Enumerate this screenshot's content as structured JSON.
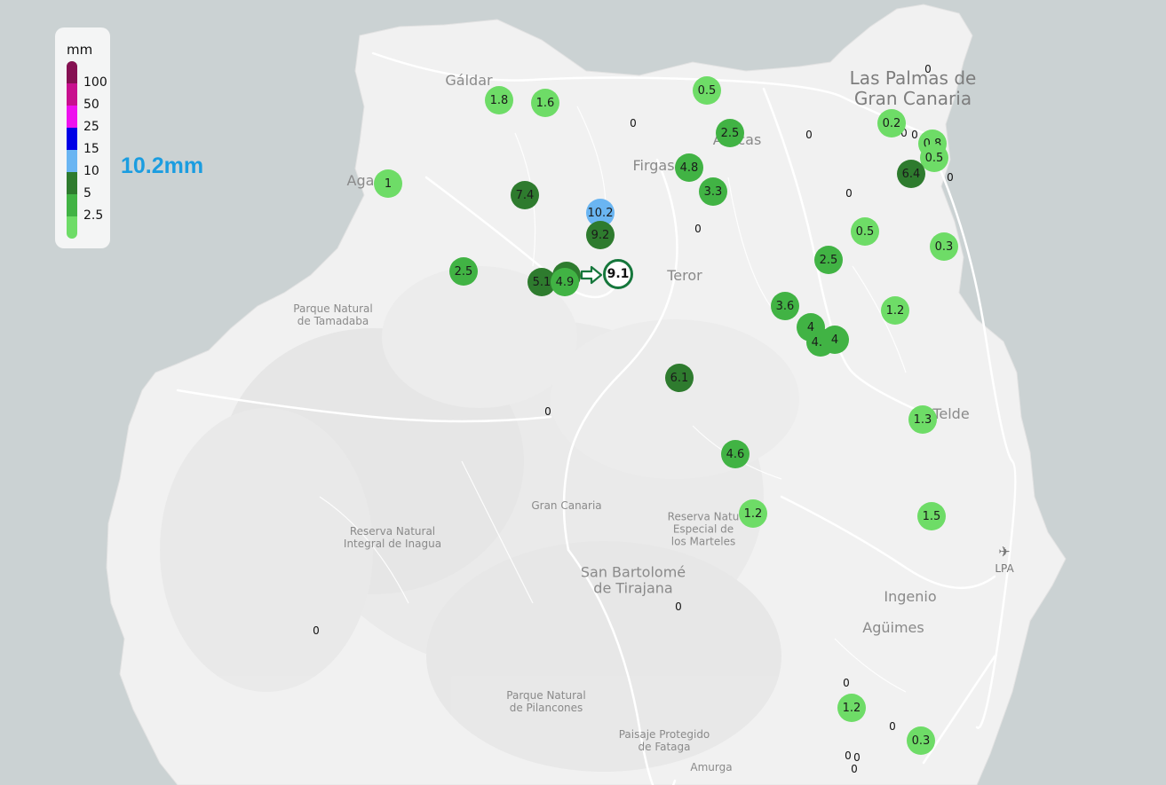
{
  "colors": {
    "sea": "#cbd2d3",
    "land": "#f1f1f1",
    "selected_ring": "#16773c",
    "max_value_text": "#1b9de0"
  },
  "legend": {
    "unit": "mm",
    "ticks": [
      "100",
      "50",
      "25",
      "15",
      "10",
      "5",
      "2.5"
    ],
    "color_scale": [
      {
        "from": 0,
        "to": 2.5,
        "color": "#6edc67"
      },
      {
        "from": 2.5,
        "to": 5,
        "color": "#41b344"
      },
      {
        "from": 5,
        "to": 10,
        "color": "#2e7b2e"
      },
      {
        "from": 10,
        "to": 15,
        "color": "#6ab5f2"
      },
      {
        "from": 15,
        "to": 25,
        "color": "#0000e6"
      },
      {
        "from": 25,
        "to": 50,
        "color": "#ee11ee"
      },
      {
        "from": 50,
        "to": 100,
        "color": "#c8108e"
      },
      {
        "from": 100,
        "to": 1000,
        "color": "#851052"
      }
    ]
  },
  "max_value": "10.2mm",
  "places": {
    "las_palmas": "Las Palmas de\nGran Canaria",
    "galdar": "Gáldar",
    "firgas": "Firgas",
    "arucas": "Arucas",
    "agaete": "Aga",
    "teror": "Teror",
    "telde": "Telde",
    "ingenio": "Ingenio",
    "aguimes": "Agüimes",
    "san_bartolome": "San Bartolomé\nde Tirajana",
    "gran_canaria": "Gran Canaria",
    "tamadaba": "Parque Natural\nde Tamadaba",
    "inagua": "Reserva Natural\nIntegral de Inagua",
    "marteles": "Reserva Natu\nEspecial de\nlos Marteles",
    "pilancones": "Parque Natural\nde Pilancones",
    "fataga": "Paisaje Protegido\nde Fataga",
    "amurga": "Amurga",
    "airport": "LPA"
  },
  "selected_station": {
    "value": "9.1"
  },
  "stations": [
    {
      "value": "1.8",
      "mm": 1.8
    },
    {
      "value": "1.6",
      "mm": 1.6
    },
    {
      "value": "0.5",
      "mm": 0.5
    },
    {
      "value": "2.5",
      "mm": 2.5
    },
    {
      "value": "4.8",
      "mm": 4.8
    },
    {
      "value": "3.3",
      "mm": 3.3
    },
    {
      "value": "1",
      "mm": 1
    },
    {
      "value": "7.4",
      "mm": 7.4
    },
    {
      "value": "10.2",
      "mm": 10.2
    },
    {
      "value": "9.2",
      "mm": 9.2
    },
    {
      "value": "2.5",
      "mm": 2.5
    },
    {
      "value": "5.1",
      "mm": 5.1
    },
    {
      "value": "9.1",
      "mm": 9.1
    },
    {
      "value": "4.9",
      "mm": 4.9
    },
    {
      "value": "0.2",
      "mm": 0.2
    },
    {
      "value": "0.8",
      "mm": 0.8
    },
    {
      "value": "0.5",
      "mm": 0.5
    },
    {
      "value": "6.4",
      "mm": 6.4
    },
    {
      "value": "0.5",
      "mm": 0.5
    },
    {
      "value": "0.3",
      "mm": 0.3
    },
    {
      "value": "2.5",
      "mm": 2.5
    },
    {
      "value": "1.2",
      "mm": 1.2
    },
    {
      "value": "3.6",
      "mm": 3.6
    },
    {
      "value": "4",
      "mm": 4
    },
    {
      "value": "4.4",
      "mm": 4.4
    },
    {
      "value": "4",
      "mm": 4
    },
    {
      "value": "6.1",
      "mm": 6.1
    },
    {
      "value": "1.3",
      "mm": 1.3
    },
    {
      "value": "4.6",
      "mm": 4.6
    },
    {
      "value": "1.2",
      "mm": 1.2
    },
    {
      "value": "1.5",
      "mm": 1.5
    },
    {
      "value": "1.2",
      "mm": 1.2
    },
    {
      "value": "0.3",
      "mm": 0.3
    }
  ],
  "zero_readings": [
    "0",
    "0",
    "0",
    "0",
    "0",
    "0",
    "0",
    "0",
    "0",
    "0",
    "0",
    "0",
    "0",
    "0",
    "0",
    "0"
  ]
}
